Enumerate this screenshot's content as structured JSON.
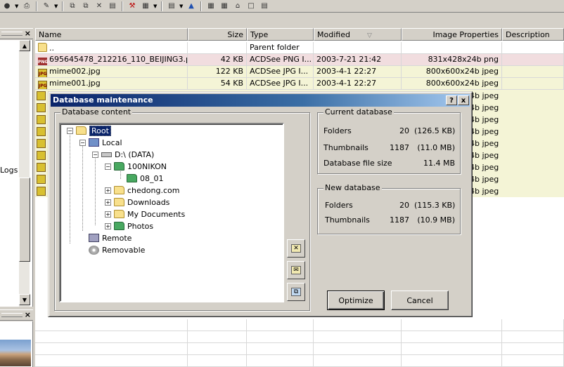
{
  "file_list": {
    "columns": [
      "Name",
      "Size",
      "Type",
      "Modified",
      "Image Properties",
      "Description"
    ],
    "rows": [
      {
        "name": "..",
        "size": "",
        "type": "Parent folder",
        "modified": "",
        "props": "",
        "kind": "folder"
      },
      {
        "name": "695645478_212216_110_BEIJING3.png",
        "size": "42 KB",
        "type": "ACDSee PNG I...",
        "modified": "2003-7-21 21:42",
        "props": "831x428x24b png",
        "kind": "png"
      },
      {
        "name": "mime002.jpg",
        "size": "122 KB",
        "type": "ACDSee JPG I...",
        "modified": "2003-4-1 22:27",
        "props": "800x600x24b jpeg",
        "kind": "jpg"
      },
      {
        "name": "mime001.jpg",
        "size": "54 KB",
        "type": "ACDSee JPG I...",
        "modified": "2003-4-1 22:27",
        "props": "800x600x24b jpeg",
        "kind": "jpg"
      }
    ],
    "obscured_props": [
      "4b jpeg",
      "4b jpeg",
      "4b jpeg",
      "4b jpeg",
      "4b jpeg",
      "4b jpeg",
      "4b jpeg",
      "4b jpeg",
      "4b jpeg"
    ]
  },
  "left_pane": {
    "partial_text": "Logs"
  },
  "dialog": {
    "title": "Database maintenance",
    "help_label": "?",
    "close_label": "x",
    "content_group_label": "Database content",
    "tree": {
      "root": "Root",
      "local": "Local",
      "drive": "D:\\ (DATA)",
      "folder_100nikon": "100NIKON",
      "folder_08_01": "08_01",
      "folder_chedong": "chedong.com",
      "folder_downloads": "Downloads",
      "folder_mydocs": "My Documents",
      "folder_photos": "Photos",
      "remote": "Remote",
      "removable": "Removable"
    },
    "current_db": {
      "label": "Current database",
      "folders_label": "Folders",
      "folders_count": "20",
      "folders_size": "(126.5 KB)",
      "thumbs_label": "Thumbnails",
      "thumbs_count": "1187",
      "thumbs_size": "(11.0 MB)",
      "dbsize_label": "Database file size",
      "dbsize_value": "11.4 MB"
    },
    "new_db": {
      "label": "New database",
      "folders_label": "Folders",
      "folders_count": "20",
      "folders_size": "(115.3 KB)",
      "thumbs_label": "Thumbnails",
      "thumbs_count": "1187",
      "thumbs_size": "(10.9 MB)"
    },
    "optimize_label": "Optimize",
    "cancel_label": "Cancel"
  }
}
